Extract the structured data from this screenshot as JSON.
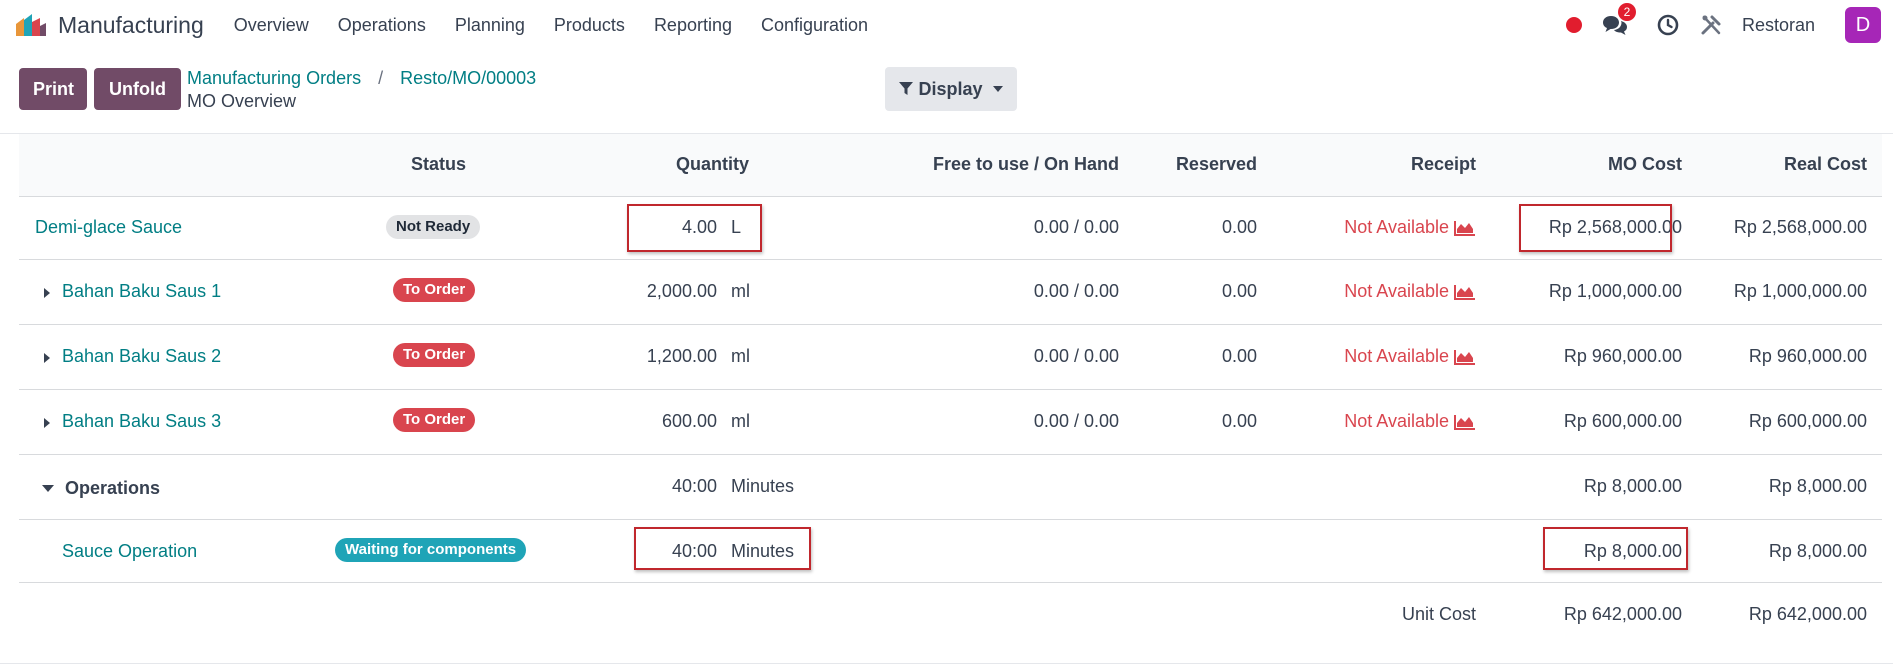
{
  "navbar": {
    "app_name": "Manufacturing",
    "menu": [
      "Overview",
      "Operations",
      "Planning",
      "Products",
      "Reporting",
      "Configuration"
    ],
    "messages_count": "2",
    "company": "Restoran",
    "avatar_letter": "D"
  },
  "control": {
    "print_label": "Print",
    "unfold_label": "Unfold",
    "breadcrumb_parent": "Manufacturing Orders",
    "breadcrumb_separator": "/",
    "breadcrumb_current": "Resto/MO/00003",
    "subtitle": "MO Overview",
    "display_label": "Display"
  },
  "table": {
    "headers": {
      "status": "Status",
      "quantity": "Quantity",
      "free_on_hand": "Free to use / On Hand",
      "reserved": "Reserved",
      "receipt": "Receipt",
      "mo_cost": "MO Cost",
      "real_cost": "Real Cost"
    },
    "main": {
      "name": "Demi-glace Sauce",
      "status": "Not Ready",
      "qty": "4.00",
      "uom": "L",
      "free_on_hand": "0.00 / 0.00",
      "reserved": "0.00",
      "receipt": "Not Available",
      "mo_cost": "Rp 2,568,000.00",
      "real_cost": "Rp 2,568,000.00"
    },
    "components": [
      {
        "name": "Bahan Baku Saus 1",
        "status": "To Order",
        "qty": "2,000.00",
        "uom": "ml",
        "free_on_hand": "0.00 / 0.00",
        "reserved": "0.00",
        "receipt": "Not Available",
        "mo_cost": "Rp 1,000,000.00",
        "real_cost": "Rp 1,000,000.00"
      },
      {
        "name": "Bahan Baku Saus 2",
        "status": "To Order",
        "qty": "1,200.00",
        "uom": "ml",
        "free_on_hand": "0.00 / 0.00",
        "reserved": "0.00",
        "receipt": "Not Available",
        "mo_cost": "Rp 960,000.00",
        "real_cost": "Rp 960,000.00"
      },
      {
        "name": "Bahan Baku Saus 3",
        "status": "To Order",
        "qty": "600.00",
        "uom": "ml",
        "free_on_hand": "0.00 / 0.00",
        "reserved": "0.00",
        "receipt": "Not Available",
        "mo_cost": "Rp 600,000.00",
        "real_cost": "Rp 600,000.00"
      }
    ],
    "operations": {
      "label": "Operations",
      "qty": "40:00",
      "uom": "Minutes",
      "mo_cost": "Rp 8,000.00",
      "real_cost": "Rp 8,000.00"
    },
    "operation": {
      "name": "Sauce Operation",
      "status": "Waiting for components",
      "qty": "40:00",
      "uom": "Minutes",
      "mo_cost": "Rp 8,000.00",
      "real_cost": "Rp 8,000.00"
    },
    "unit_cost": {
      "label": "Unit Cost",
      "mo_cost": "Rp 642,000.00",
      "real_cost": "Rp 642,000.00"
    }
  },
  "colors": {
    "brand": "#714b67",
    "link": "#017e84",
    "danger": "#d9454e",
    "info": "#1fa4b7",
    "highlight": "#c0272d"
  }
}
